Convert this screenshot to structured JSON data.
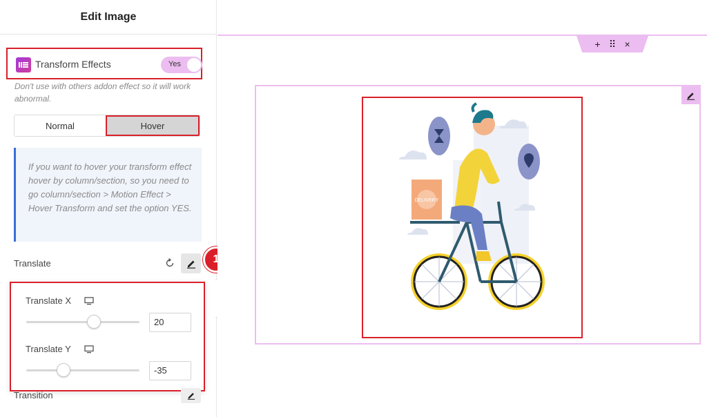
{
  "panel": {
    "title": "Edit Image",
    "transform_effects": {
      "label": "Transform Effects",
      "toggle_value": "Yes",
      "note": "Don't use with others addon effect so it will work abnormal."
    },
    "tabs": [
      {
        "label": "Normal",
        "active": false
      },
      {
        "label": "Hover",
        "active": true
      }
    ],
    "info_text": "If you want to hover your transform effect hover by column/section, so you need to go column/section > Motion Effect > Hover Transform and set the option YES.",
    "translate": {
      "label": "Translate",
      "step_badge": "1",
      "x": {
        "label": "Translate X",
        "value": "20",
        "slider_fraction": 0.6
      },
      "y": {
        "label": "Translate Y",
        "value": "-35",
        "slider_fraction": 0.33
      }
    },
    "transition_label": "Transition"
  },
  "canvas": {
    "section_handle": {
      "add": "+",
      "drag": "⠿",
      "close": "×"
    },
    "accent_color": "#ecbdf0",
    "highlight_color": "#d9202a",
    "box_label": "DELIVERY"
  }
}
